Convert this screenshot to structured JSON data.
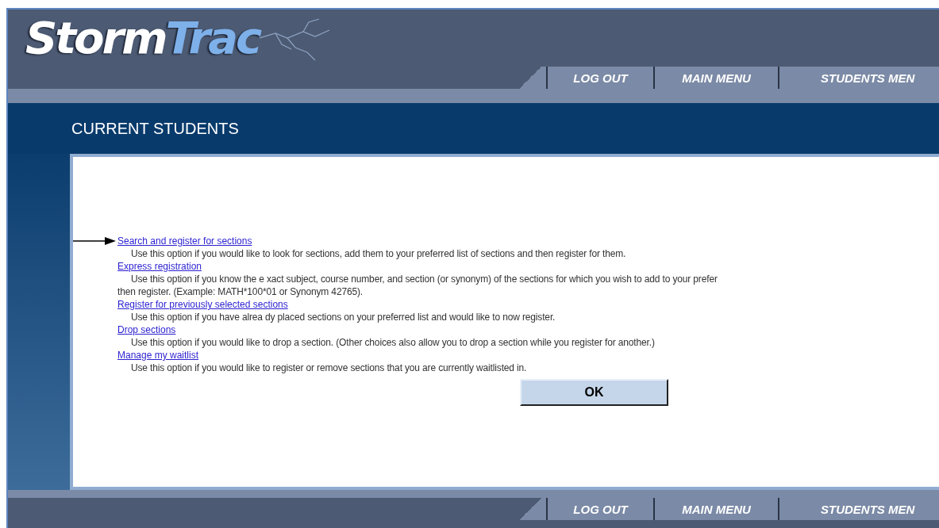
{
  "header": {
    "logo": [
      "Storm",
      "Trac"
    ],
    "nav": [
      {
        "label": "LOG OUT"
      },
      {
        "label": "MAIN MENU"
      },
      {
        "label": "STUDENTS MEN"
      }
    ]
  },
  "page_title": "CURRENT STUDENTS",
  "options": [
    {
      "link": "Search and register for sections",
      "pointed": true,
      "description": [
        "Use this option if you would like to look for sections, add them to your preferred  list of sections and then register for them."
      ]
    },
    {
      "link": "Express registration",
      "pointed": false,
      "description": [
        "Use this option if you know the e xact subject, course number, and section (or synonym) of the sections for which  you wish  to add to your prefer",
        "then register. (Example: MATH*100*01 or Synonym 42765)."
      ]
    },
    {
      "link": "Register for previously  selected sections",
      "pointed": false,
      "description": [
        "Use this option if you have  alrea dy placed sections on your preferred  list and would  like to now  register."
      ]
    },
    {
      "link": "Drop sections",
      "pointed": false,
      "description": [
        "Use this option if you would like to drop a section. (Other choices also allow you to drop a section while you register for  another.)"
      ]
    },
    {
      "link": "Manage my waitlist",
      "pointed": false,
      "description": [
        "Use this option if you would like to register or remove  sections that you are currently waitlisted in."
      ]
    }
  ],
  "ok_button": "OK",
  "footer": {
    "nav": [
      {
        "label": "LOG OUT"
      },
      {
        "label": "MAIN MENU"
      },
      {
        "label": "STUDENTS MEN"
      }
    ]
  }
}
